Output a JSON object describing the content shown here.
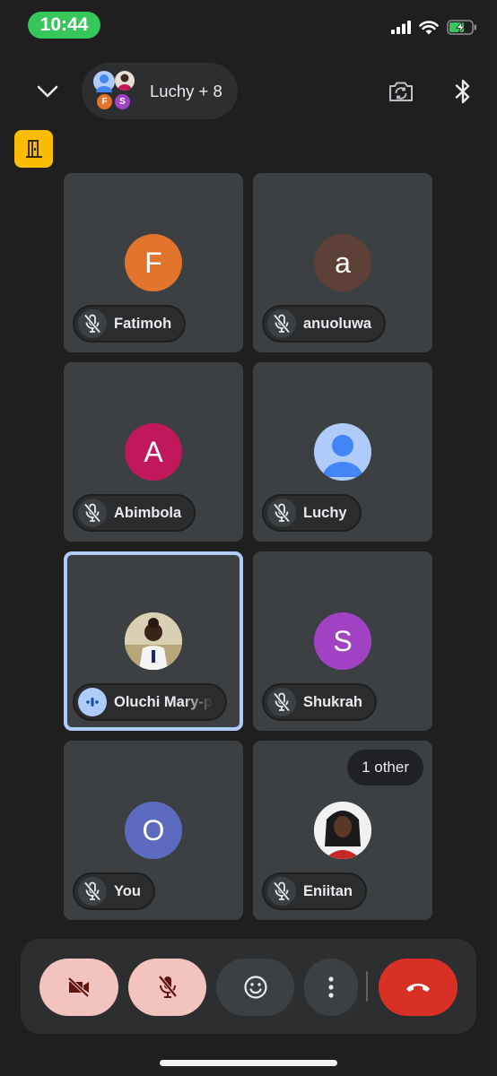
{
  "status_bar": {
    "time": "10:44"
  },
  "header": {
    "participants_label": "Luchy + 8",
    "cluster_initials": [
      "F",
      "S"
    ]
  },
  "tiles": [
    {
      "name": "Fatimoh",
      "initial": "F",
      "color": "#e2742c",
      "mic": "muted"
    },
    {
      "name": "anuoluwa",
      "initial": "a",
      "color": "#5d4037",
      "mic": "muted"
    },
    {
      "name": "Abimbola",
      "initial": "A",
      "color": "#c2185b",
      "mic": "muted"
    },
    {
      "name": "Luchy",
      "initial": "",
      "color": "#aecbfa",
      "mic": "muted"
    },
    {
      "name": "Oluchi Mary-p",
      "initial": "",
      "color": "#d9d0b4",
      "mic": "speaking"
    },
    {
      "name": "Shukrah",
      "initial": "S",
      "color": "#a142c4",
      "mic": "muted"
    },
    {
      "name": "You",
      "initial": "O",
      "color": "#5c6bc0",
      "mic": "muted"
    },
    {
      "name": "Eniitan",
      "initial": "",
      "color": "#ffffff",
      "mic": "muted",
      "badge": "1 other"
    }
  ],
  "controls": {
    "camera": "off",
    "mic": "off",
    "end_call_color": "#d93025",
    "muted_bg": "#f2c3bf"
  }
}
